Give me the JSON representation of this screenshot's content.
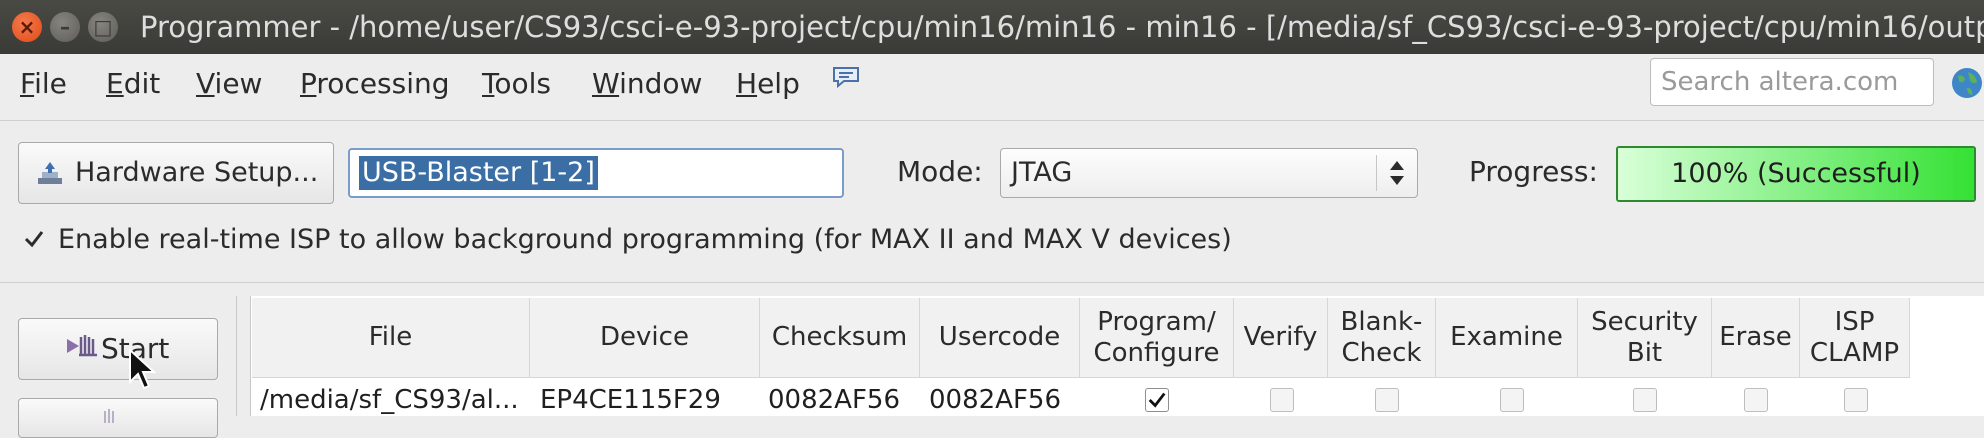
{
  "window": {
    "title": "Programmer - /home/user/CS93/csci-e-93-project/cpu/min16/min16 - min16 - [/media/sf_CS93/csci-e-93-project/cpu/min16/output_",
    "controls": [
      "close-icon",
      "minimize-icon",
      "maximize-icon"
    ]
  },
  "menu": {
    "items": [
      "File",
      "Edit",
      "View",
      "Processing",
      "Tools",
      "Window",
      "Help"
    ],
    "search_placeholder": "Search altera.com"
  },
  "toolbar": {
    "hardware_setup_label": "Hardware Setup...",
    "hardware_value": "USB-Blaster [1-2]",
    "mode_label": "Mode:",
    "mode_value": "JTAG",
    "progress_label": "Progress:",
    "progress_text": "100% (Successful)",
    "progress_fraction": 1.0,
    "progress_color": "#34e134"
  },
  "isp": {
    "checked": true,
    "label": "Enable real-time ISP to allow background programming (for MAX II and MAX V devices)"
  },
  "side": {
    "start_label": "Start"
  },
  "table": {
    "columns": [
      "File",
      "Device",
      "Checksum",
      "Usercode",
      "Program/\nConfigure",
      "Verify",
      "Blank-\nCheck",
      "Examine",
      "Security\nBit",
      "Erase",
      "ISP\nCLAMP"
    ],
    "rows": [
      {
        "file": "/media/sf_CS93/al...",
        "device": "EP4CE115F29",
        "checksum": "0082AF56",
        "usercode": "0082AF56",
        "program_configure": true,
        "verify": false,
        "blank_check": false,
        "examine": false,
        "security_bit": false,
        "erase": false,
        "isp_clamp": false
      }
    ]
  },
  "colors": {
    "title_bar": "#3f3f3b",
    "close_button": "#e9541e",
    "selection": "#3a6ea5",
    "progress_border": "#2f8a2f"
  }
}
